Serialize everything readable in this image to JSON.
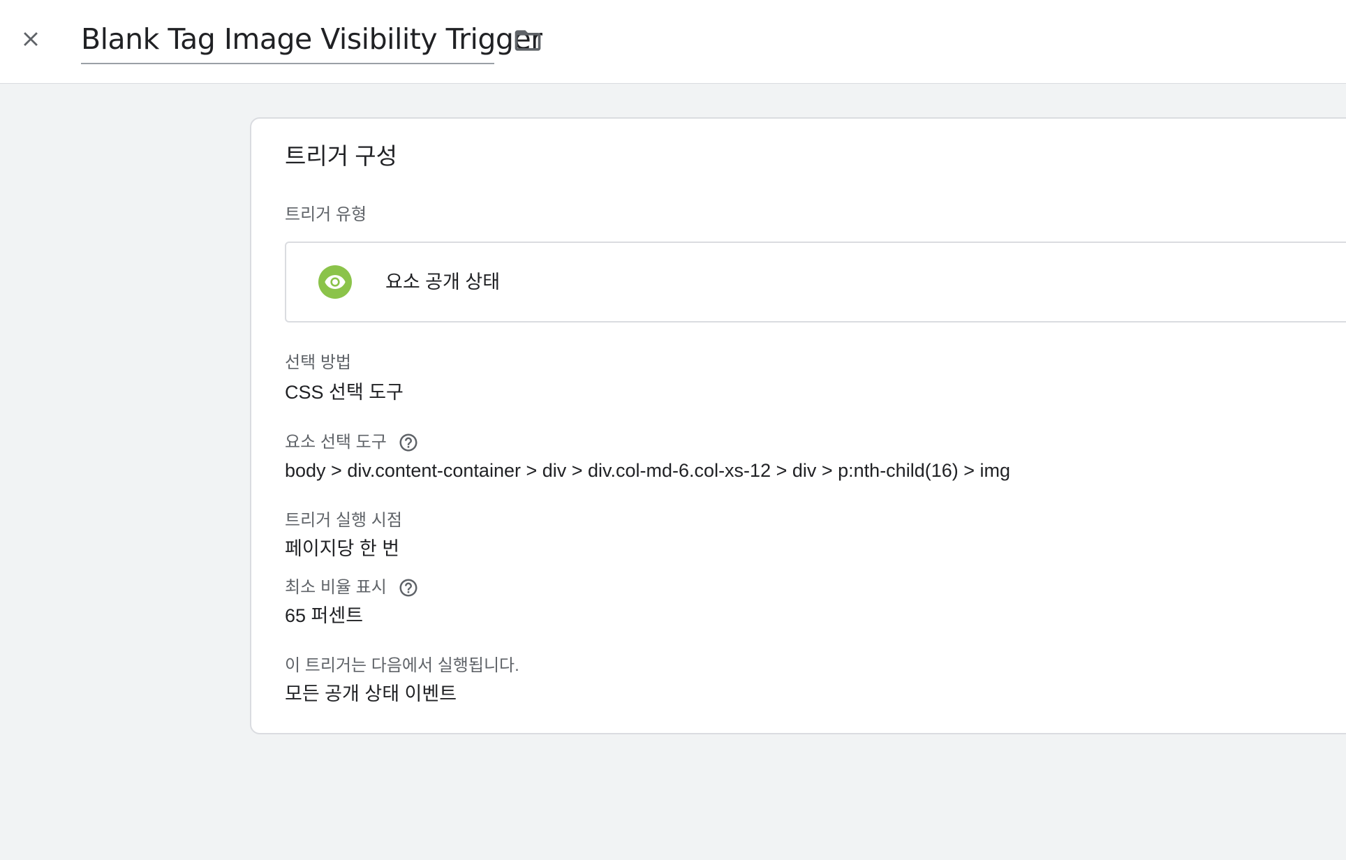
{
  "header": {
    "title": "Blank Tag Image Visibility Trigger",
    "close_icon": "close-icon",
    "folder_icon": "folder-icon"
  },
  "card": {
    "title": "트리거 구성",
    "trigger_type": {
      "label": "트리거 유형",
      "name": "요소 공개 상태",
      "icon": "eye-icon",
      "icon_color": "#8bc34a"
    },
    "selection_method": {
      "label": "선택 방법",
      "value": "CSS 선택 도구"
    },
    "element_selector": {
      "label": "요소 선택 도구",
      "value": "body > div.content-container > div > div.col-md-6.col-xs-12 > div > p:nth-child(16) > img",
      "help_icon": "help-icon"
    },
    "fire_timing": {
      "label": "트리거 실행 시점",
      "value": "페이지당 한 번"
    },
    "min_percent_visible": {
      "label": "최소 비율 표시",
      "value": "65 퍼센트",
      "help_icon": "help-icon"
    },
    "fires_on": {
      "label": "이 트리거는 다음에서 실행됩니다.",
      "value": "모든 공개 상태 이벤트"
    }
  }
}
